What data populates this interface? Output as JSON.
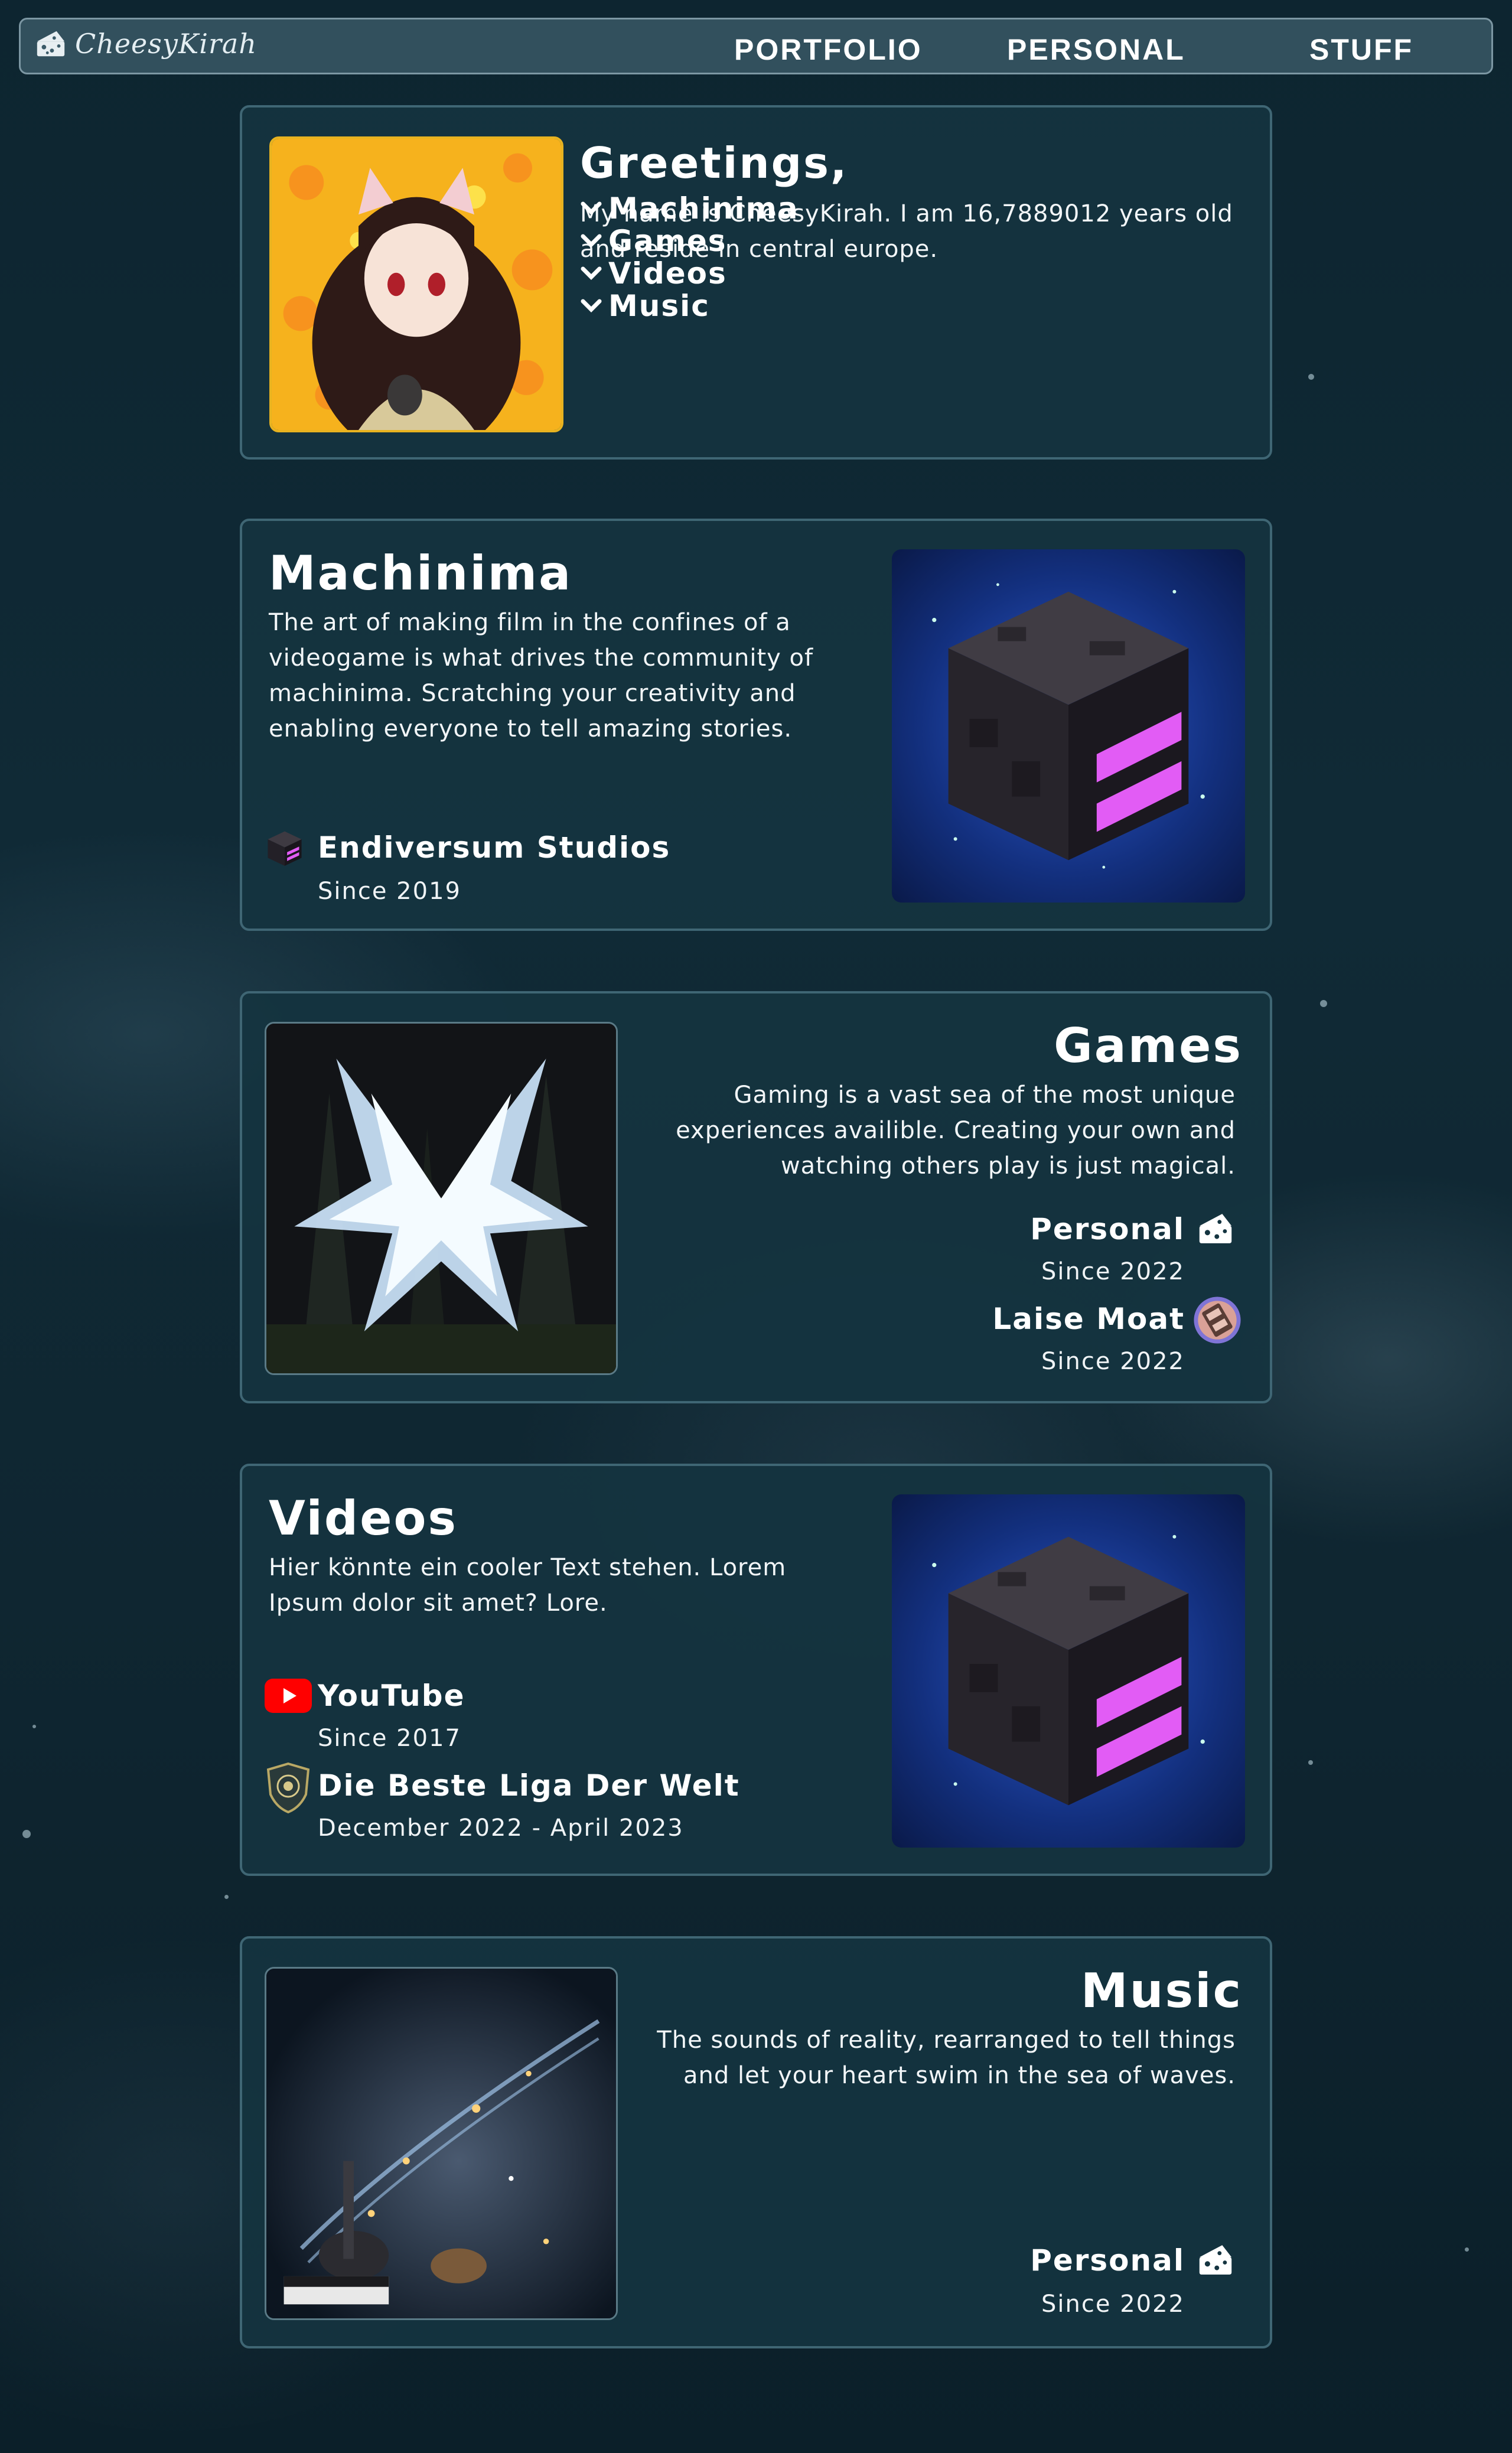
{
  "nav": {
    "brand": "CheesyKirah",
    "links": [
      "PORTFOLIO",
      "PERSONAL",
      "STUFF"
    ]
  },
  "greetings": {
    "title": "Greetings,",
    "text": "My name is CheesyKirah. I am 16,7889012 years old and reside in central europe.",
    "links": [
      "Machinima",
      "Games",
      "Videos",
      "Music"
    ]
  },
  "machinima": {
    "title": "Machinima",
    "text": "The art of making film in the confines of a videogame is what drives the community of machinima. Scratching your creativity and enabling everyone to tell amazing stories.",
    "items": [
      {
        "name": "Endiversum Studios",
        "sub": "Since 2019",
        "icon": "ender-cube-icon"
      }
    ]
  },
  "games": {
    "title": "Games",
    "text": "Gaming is a vast sea of the most unique experiences availible. Creating your own and watching others play is just magical.",
    "items": [
      {
        "name": "Personal",
        "sub": "Since 2022",
        "icon": "cheese-icon"
      },
      {
        "name": "Laise Moat",
        "sub": "Since 2022",
        "icon": "laise-moat-icon"
      }
    ]
  },
  "videos": {
    "title": "Videos",
    "text": "Hier könnte ein cooler Text stehen. Lorem Ipsum dolor sit amet? Lore.",
    "items": [
      {
        "name": "YouTube",
        "sub": "Since 2017",
        "icon": "youtube-icon"
      },
      {
        "name": "Die Beste Liga Der Welt",
        "sub": "December 2022 - April 2023",
        "icon": "league-crest-icon"
      }
    ]
  },
  "music": {
    "title": "Music",
    "text": "The sounds of reality, rearranged to tell things and let your heart swim in the sea of waves.",
    "items": [
      {
        "name": "Personal",
        "sub": "Since 2022",
        "icon": "cheese-icon"
      }
    ]
  },
  "colors": {
    "background": "#0f2631",
    "card": "#143440",
    "card_border": "#3f6674",
    "nav": "#3a5a68",
    "ender_accent": "#e25cf5"
  }
}
